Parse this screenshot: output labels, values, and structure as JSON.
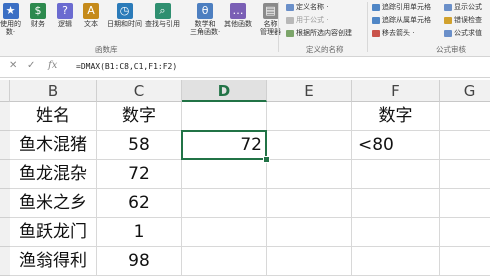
{
  "ribbon": {
    "buttons": [
      {
        "label": "使用的\n数·",
        "icon_color": "#3b6fc4",
        "glyph": "★"
      },
      {
        "label": "财务",
        "icon_color": "#2d8a4e",
        "glyph": "$"
      },
      {
        "label": "逻辑",
        "icon_color": "#6b6bd0",
        "glyph": "?"
      },
      {
        "label": "文本",
        "icon_color": "#c58a1a",
        "glyph": "A"
      },
      {
        "label": "日期和时间",
        "icon_color": "#2b7bb9",
        "glyph": "◷"
      },
      {
        "label": "查找与引用",
        "icon_color": "#2f8f70",
        "glyph": "⌕"
      },
      {
        "label": "数学和\n三角函数·",
        "icon_color": "#4d7fc0",
        "glyph": "θ"
      },
      {
        "label": "其他函数",
        "icon_color": "#7a5fb5",
        "glyph": "…"
      },
      {
        "label": "名称\n管理器",
        "icon_color": "#8a8a8a",
        "glyph": "▤"
      }
    ],
    "group_function_library": "函数库",
    "group_defined_names": "定义的名称",
    "group_formula_auditing": "公式审核",
    "defined_names_cmds": [
      "定义名称 ·",
      "用于公式 ·",
      "根据所选内容创建"
    ],
    "auditing_cmds_col1": [
      "追踪引用单元格",
      "追踪从属单元格",
      "移去箭头 ·"
    ],
    "auditing_cmds_col2": [
      "显示公式",
      "错误检查",
      "公式求值"
    ]
  },
  "formula_bar": {
    "cancel_icon": "x-icon",
    "enter_icon": "check-icon",
    "fx_label": "fx",
    "formula": "=DMAX(B1:C8,C1,F1:F2)"
  },
  "columns": [
    "B",
    "C",
    "D",
    "E",
    "F",
    "G"
  ],
  "active_column": "D",
  "cells": {
    "B1": "姓名",
    "C1": "数字",
    "F1": "数字",
    "B2": "鱼木混猪",
    "C2": "58",
    "D2": "72",
    "F2": "<80",
    "B3": "鱼龙混杂",
    "C3": "72",
    "B4": "鱼米之乡",
    "C4": "62",
    "B5": "鱼跃龙门",
    "C5": "1",
    "B6": "渔翁得利",
    "C6": "98"
  },
  "colors": {
    "accent": "#217346",
    "ribbon_bg": "#f3f3f3",
    "header_bg": "#f1f1f1"
  }
}
